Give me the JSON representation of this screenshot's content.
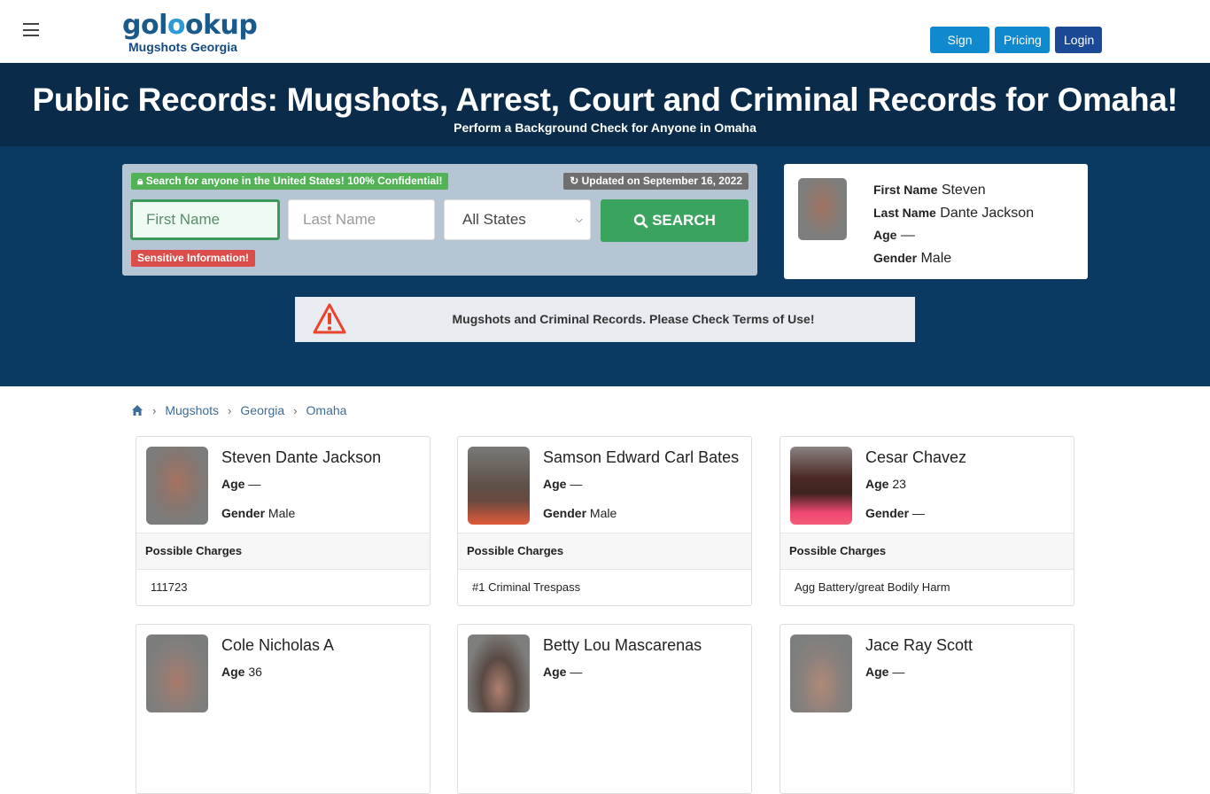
{
  "header": {
    "logo_main_a": "gol",
    "logo_main_b": "o",
    "logo_main_c": "okup",
    "logo_sub": "Mugshots Georgia",
    "menu_icon": "hamburger-icon",
    "buttons": {
      "signup": "Sign Up",
      "pricing": "Pricing",
      "login": "Login"
    }
  },
  "hero": {
    "title": "Public Records: Mugshots, Arrest, Court and Criminal Records for Omaha!",
    "subtitle": "Perform a Background Check for Anyone in Omaha"
  },
  "search": {
    "confidential_badge": "Search for anyone in the United States! 100% Confidential!",
    "updated_badge": "Updated on September 16, 2022",
    "first_name_placeholder": "First Name",
    "last_name_placeholder": "Last Name",
    "state_selected": "All States",
    "search_button": "SEARCH",
    "sensitive_badge": "Sensitive Information!"
  },
  "profile": {
    "first_name_label": "First Name",
    "first_name": "Steven",
    "last_name_label": "Last Name",
    "last_name": "Dante Jackson",
    "age_label": "Age",
    "age": "—",
    "gender_label": "Gender",
    "gender": "Male"
  },
  "warning": {
    "text": "Mugshots and Criminal Records. Please Check Terms of Use!",
    "icon": "warning-triangle-icon"
  },
  "breadcrumb": [
    {
      "label": "Mugshots"
    },
    {
      "label": "Georgia"
    },
    {
      "label": "Omaha"
    }
  ],
  "colors": {
    "header_band": "#0a2b49",
    "hero_body": "#0a3a61",
    "search_green": "#3aa35e",
    "login_blue": "#1b4996",
    "signup_blue": "#1189cf",
    "warning_red": "#e8452c"
  },
  "records": [
    {
      "name": "Steven Dante Jackson",
      "age_label": "Age",
      "age": "—",
      "gender_label": "Gender",
      "gender": "Male",
      "charges_label": "Possible Charges",
      "charge": "111723"
    },
    {
      "name": "Samson Edward Carl Bates",
      "age_label": "Age",
      "age": "—",
      "gender_label": "Gender",
      "gender": "Male",
      "charges_label": "Possible Charges",
      "charge": "#1 Criminal Trespass"
    },
    {
      "name": "Cesar Chavez",
      "age_label": "Age",
      "age": "23",
      "gender_label": "Gender",
      "gender": "—",
      "charges_label": "Possible Charges",
      "charge": "Agg Battery/great Bodily Harm"
    },
    {
      "name": "Cole Nicholas A",
      "age_label": "Age",
      "age": "36"
    },
    {
      "name": "Betty Lou Mascarenas",
      "age_label": "Age",
      "age": "—"
    },
    {
      "name": "Jace Ray Scott",
      "age_label": "Age",
      "age": "—"
    }
  ]
}
